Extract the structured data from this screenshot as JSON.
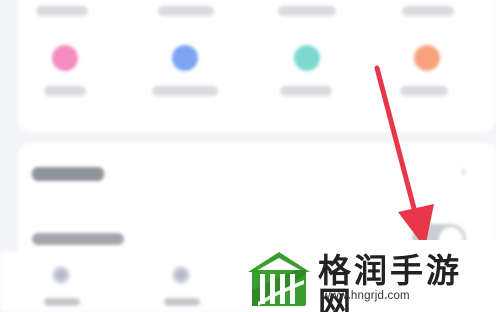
{
  "colors": {
    "page_background": "#f3f4f7",
    "card_background": "#ffffff",
    "arrow": "#e8364a",
    "icon_pink": "#f58bbf",
    "icon_blue": "#7ba4f2",
    "icon_teal": "#7dd8cf",
    "icon_orange": "#f7a27d",
    "watermark_green": "#3a9e2f",
    "watermark_dot": "#e0332d"
  },
  "app_grid": {
    "icons": [
      {
        "name": "pink-app-icon",
        "color": "#f58bbf"
      },
      {
        "name": "blue-app-icon",
        "color": "#7ba4f2"
      },
      {
        "name": "teal-app-icon",
        "color": "#7dd8cf"
      },
      {
        "name": "orange-app-icon",
        "color": "#f7a27d"
      }
    ]
  },
  "settings": {
    "rows": [
      {
        "icon": "chevron-right-icon"
      },
      {
        "toggle": "off"
      }
    ]
  },
  "tab_bar": {
    "items": [
      {
        "icon": "home-icon"
      },
      {
        "icon": "discover-icon"
      }
    ]
  },
  "watermark": {
    "title": "格润手游网",
    "url_prefix": "www",
    "url_domain": "hngrjd",
    "url_suffix": "com"
  }
}
